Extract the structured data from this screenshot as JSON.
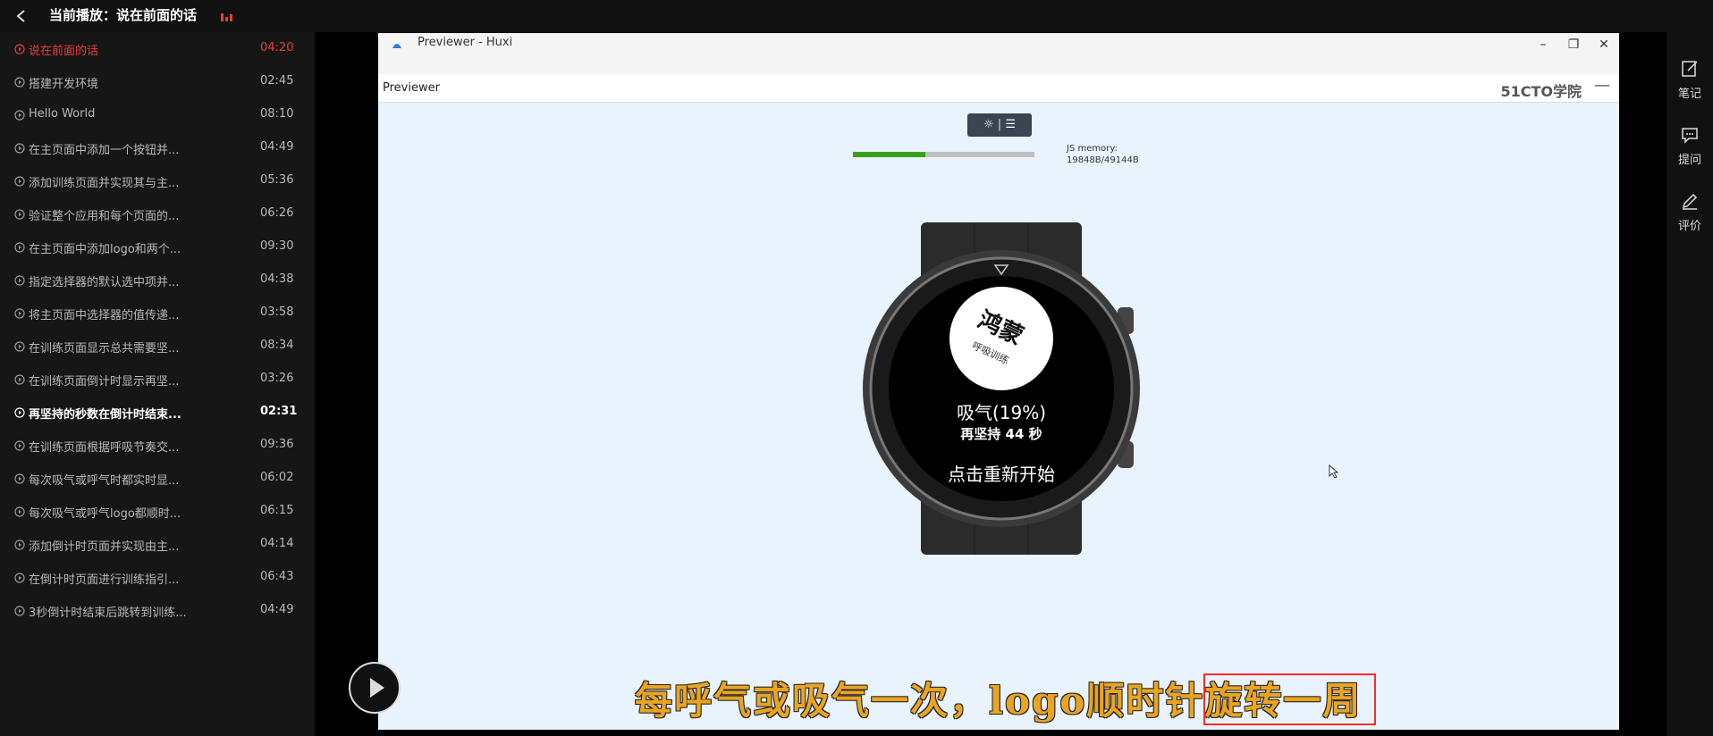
{
  "header": {
    "title": "当前播放：说在前面的话"
  },
  "playlist": [
    {
      "title": "说在前面的话",
      "duration": "04:20",
      "state": "active"
    },
    {
      "title": "搭建开发环境",
      "duration": "02:45",
      "state": ""
    },
    {
      "title": "Hello World",
      "duration": "08:10",
      "state": ""
    },
    {
      "title": "在主页面中添加一个按钮并...",
      "duration": "04:49",
      "state": ""
    },
    {
      "title": "添加训练页面并实现其与主...",
      "duration": "05:36",
      "state": ""
    },
    {
      "title": "验证整个应用和每个页面的...",
      "duration": "06:26",
      "state": ""
    },
    {
      "title": "在主页面中添加logo和两个...",
      "duration": "09:30",
      "state": ""
    },
    {
      "title": "指定选择器的默认选中项并...",
      "duration": "04:38",
      "state": ""
    },
    {
      "title": "将主页面中选择器的值传递...",
      "duration": "03:58",
      "state": ""
    },
    {
      "title": "在训练页面显示总共需要坚...",
      "duration": "08:34",
      "state": ""
    },
    {
      "title": "在训练页面倒计时显示再坚...",
      "duration": "03:26",
      "state": ""
    },
    {
      "title": "再坚持的秒数在倒计时结束...",
      "duration": "02:31",
      "state": "bold"
    },
    {
      "title": "在训练页面根据呼吸节奏交...",
      "duration": "09:36",
      "state": ""
    },
    {
      "title": "每次吸气或呼气时都实时显...",
      "duration": "06:02",
      "state": ""
    },
    {
      "title": "每次吸气或呼气logo都顺时...",
      "duration": "06:15",
      "state": ""
    },
    {
      "title": "添加倒计时页面并实现由主...",
      "duration": "04:14",
      "state": ""
    },
    {
      "title": "在倒计时页面进行训练指引...",
      "duration": "06:43",
      "state": ""
    },
    {
      "title": "3秒倒计时结束后跳转到训练...",
      "duration": "04:49",
      "state": ""
    }
  ],
  "previewer": {
    "window_title": "Previewer - Huxi",
    "sub_title": "Previewer",
    "watermark": "51CTO学院",
    "memory_label": "JS memory:",
    "memory_value": "19848B/49144B",
    "memory_fraction": 0.4
  },
  "watch": {
    "logo_text": "鸿蒙",
    "logo_sub": "呼吸训练",
    "status": "吸气(19%)",
    "remaining": "再坚持 44 秒",
    "restart": "点击重新开始"
  },
  "subtitle": "每呼气或吸气一次，logo顺时针旋转一周",
  "rail": [
    {
      "label": "笔记",
      "icon": "note-icon"
    },
    {
      "label": "提问",
      "icon": "question-icon"
    },
    {
      "label": "评价",
      "icon": "review-icon"
    }
  ],
  "colors": {
    "active": "#ef3b3b",
    "subtitle": "#e9a423",
    "highlight_box": "#ff2a2a",
    "memory_fill": "#3da118"
  }
}
